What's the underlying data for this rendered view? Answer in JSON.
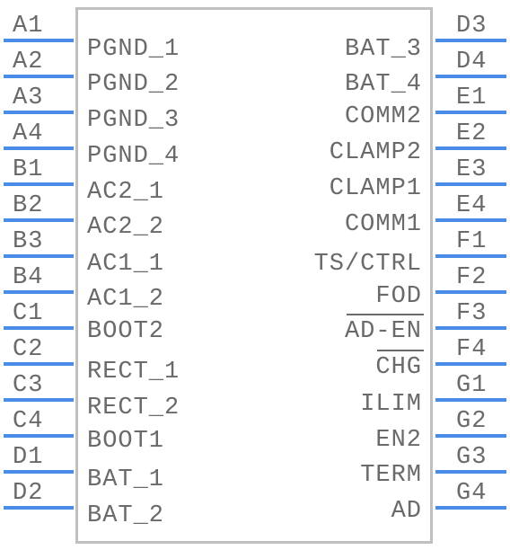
{
  "component": {
    "colors": {
      "pin": "#4a8ce8",
      "text": "#6a6a6a",
      "outline": "#c0c0c0"
    },
    "left_pins": [
      {
        "num": "A1",
        "signal": "PGND_1"
      },
      {
        "num": "A2",
        "signal": "PGND_2"
      },
      {
        "num": "A3",
        "signal": "PGND_3"
      },
      {
        "num": "A4",
        "signal": "PGND_4"
      },
      {
        "num": "B1",
        "signal": "AC2_1"
      },
      {
        "num": "B2",
        "signal": "AC2_2"
      },
      {
        "num": "B3",
        "signal": "AC1_1"
      },
      {
        "num": "B4",
        "signal": "AC1_2"
      },
      {
        "num": "C1",
        "signal": "BOOT2"
      },
      {
        "num": "C2",
        "signal": "RECT_1"
      },
      {
        "num": "C3",
        "signal": "RECT_2"
      },
      {
        "num": "C4",
        "signal": "BOOT1"
      },
      {
        "num": "D1",
        "signal": "BAT_1"
      },
      {
        "num": "D2",
        "signal": "BAT_2"
      }
    ],
    "right_pins": [
      {
        "num": "D3",
        "signal": "BAT_3"
      },
      {
        "num": "D4",
        "signal": "BAT_4"
      },
      {
        "num": "E1",
        "signal": "COMM2"
      },
      {
        "num": "E2",
        "signal": "CLAMP2"
      },
      {
        "num": "E3",
        "signal": "CLAMP1"
      },
      {
        "num": "E4",
        "signal": "COMM1"
      },
      {
        "num": "F1",
        "signal": "TS/CTRL"
      },
      {
        "num": "F2",
        "signal": "FOD"
      },
      {
        "num": "F3",
        "signal": "AD-EN",
        "active_low": true
      },
      {
        "num": "F4",
        "signal": "CHG",
        "active_low": true
      },
      {
        "num": "G1",
        "signal": "ILIM"
      },
      {
        "num": "G2",
        "signal": "EN2"
      },
      {
        "num": "G3",
        "signal": "TERM"
      },
      {
        "num": "G4",
        "signal": "AD"
      }
    ]
  }
}
